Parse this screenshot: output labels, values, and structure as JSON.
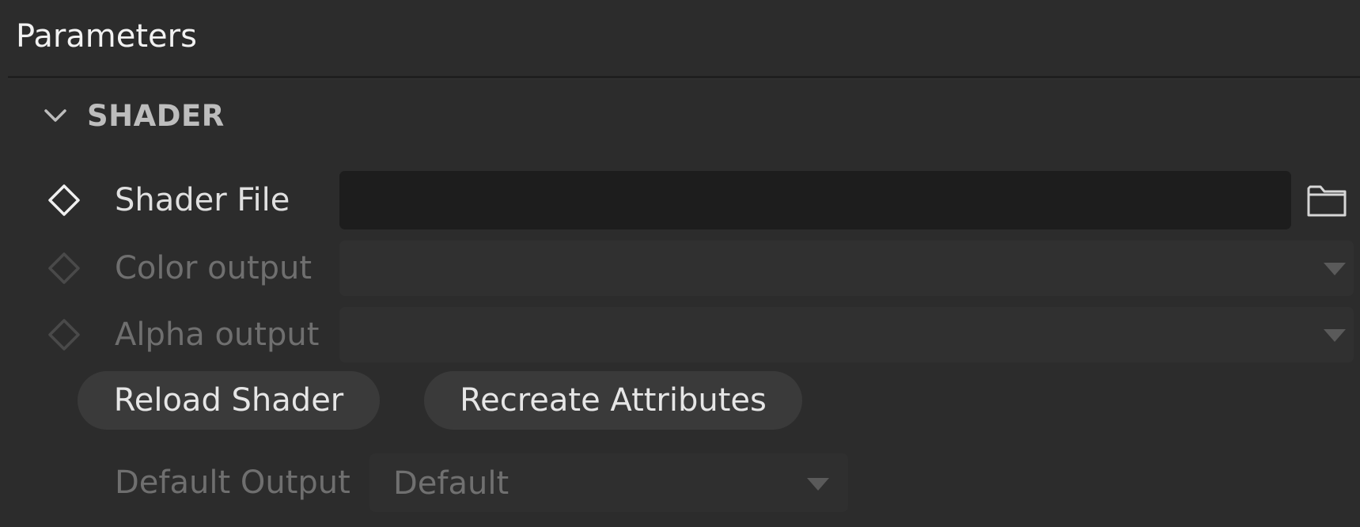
{
  "panel": {
    "title": "Parameters"
  },
  "section": {
    "label": "SHADER",
    "expanded": true,
    "icon": "chevron-down-icon"
  },
  "fields": {
    "shader_file": {
      "label": "Shader File",
      "value": "",
      "browse_icon": "folder-icon",
      "key_icon": "keyframe-diamond-icon"
    },
    "color_output": {
      "label": "Color output",
      "value": "",
      "disabled": true,
      "key_icon": "keyframe-diamond-icon"
    },
    "alpha_output": {
      "label": "Alpha output",
      "value": "",
      "disabled": true,
      "key_icon": "keyframe-diamond-icon"
    }
  },
  "buttons": {
    "reload_label": "Reload Shader",
    "recreate_label": "Recreate Attributes"
  },
  "default_output": {
    "label": "Default Output",
    "value": "Default",
    "disabled": true
  },
  "colors": {
    "background": "#2c2c2c",
    "field_dark": "#1d1d1d",
    "button": "#3a3a3a",
    "text_active": "#e0e0e0",
    "text_dim": "#6f6f6f"
  }
}
